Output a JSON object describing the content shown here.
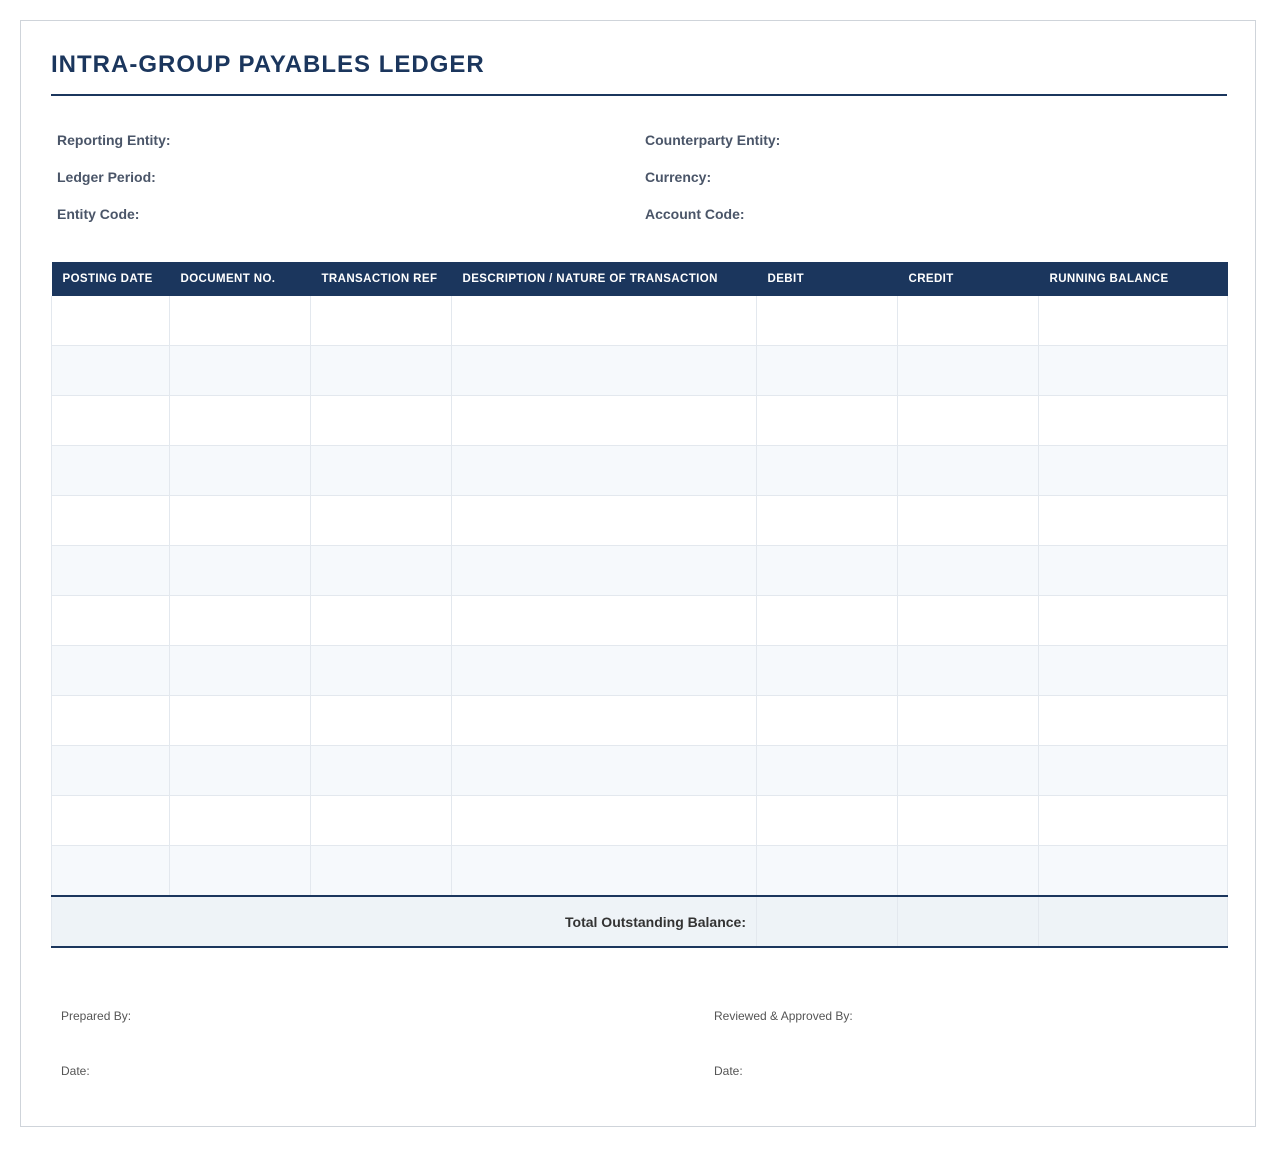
{
  "document": {
    "title": "INTRA-GROUP PAYABLES LEDGER"
  },
  "meta": {
    "left": [
      "Reporting Entity:",
      "Ledger Period:",
      "Entity Code:"
    ],
    "right": [
      "Counterparty Entity:",
      "Currency:",
      "Account Code:"
    ]
  },
  "table": {
    "columns": [
      "POSTING DATE",
      "DOCUMENT NO.",
      "TRANSACTION REF",
      "DESCRIPTION / NATURE OF TRANSACTION",
      "DEBIT",
      "CREDIT",
      "RUNNING BALANCE"
    ],
    "rows": [
      [
        "",
        "",
        "",
        "",
        "",
        "",
        ""
      ],
      [
        "",
        "",
        "",
        "",
        "",
        "",
        ""
      ],
      [
        "",
        "",
        "",
        "",
        "",
        "",
        ""
      ],
      [
        "",
        "",
        "",
        "",
        "",
        "",
        ""
      ],
      [
        "",
        "",
        "",
        "",
        "",
        "",
        ""
      ],
      [
        "",
        "",
        "",
        "",
        "",
        "",
        ""
      ],
      [
        "",
        "",
        "",
        "",
        "",
        "",
        ""
      ],
      [
        "",
        "",
        "",
        "",
        "",
        "",
        ""
      ],
      [
        "",
        "",
        "",
        "",
        "",
        "",
        ""
      ],
      [
        "",
        "",
        "",
        "",
        "",
        "",
        ""
      ],
      [
        "",
        "",
        "",
        "",
        "",
        "",
        ""
      ],
      [
        "",
        "",
        "",
        "",
        "",
        "",
        ""
      ]
    ],
    "total_label": "Total Outstanding Balance:"
  },
  "signatures": {
    "prepared_by": "Prepared By:",
    "prepared_date": "Date:",
    "reviewed_by": "Reviewed & Approved By:",
    "reviewed_date": "Date:"
  },
  "colors": {
    "primary": "#1b365d",
    "row_alt": "#f6f9fc",
    "total_bg": "#eef3f7"
  }
}
